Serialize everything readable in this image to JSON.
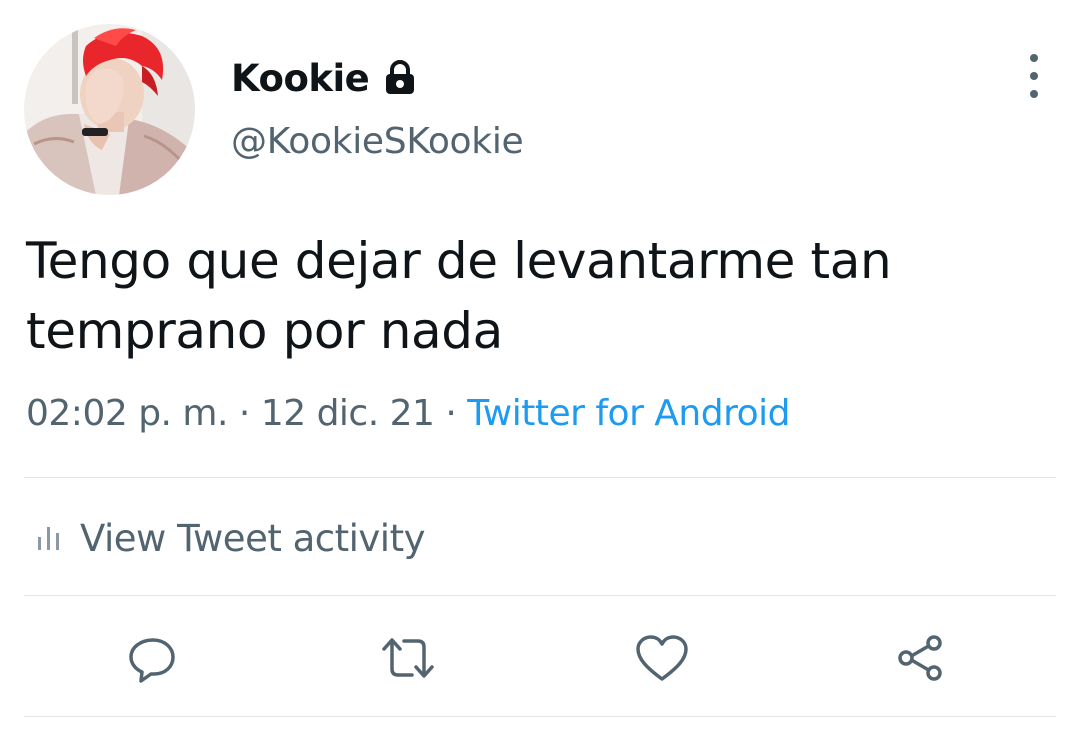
{
  "user": {
    "display_name": "Kookie",
    "handle": "@KookieSKookie",
    "avatar_icon": "profile-photo",
    "protected_icon": "lock-icon"
  },
  "tweet": {
    "text_line_1": "Tengo que dejar de levantarme tan",
    "text_line_2": "temprano por nada",
    "time": "02:02 p. m.",
    "separator": "·",
    "date": "12 dic. 21",
    "source": "Twitter for Android"
  },
  "activity": {
    "label": "View Tweet activity",
    "icon": "bar-chart-icon"
  },
  "actions": [
    {
      "name": "reply",
      "icon": "speech-bubble-icon"
    },
    {
      "name": "retweet",
      "icon": "retweet-arrows-icon"
    },
    {
      "name": "like",
      "icon": "heart-icon"
    },
    {
      "name": "share",
      "icon": "share-nodes-icon"
    }
  ],
  "colors": {
    "text_primary": "#0f1419",
    "text_secondary": "#536471",
    "link": "#1d9bf0",
    "divider": "#e3e6e9",
    "avatar_hair": "#e8262b"
  }
}
